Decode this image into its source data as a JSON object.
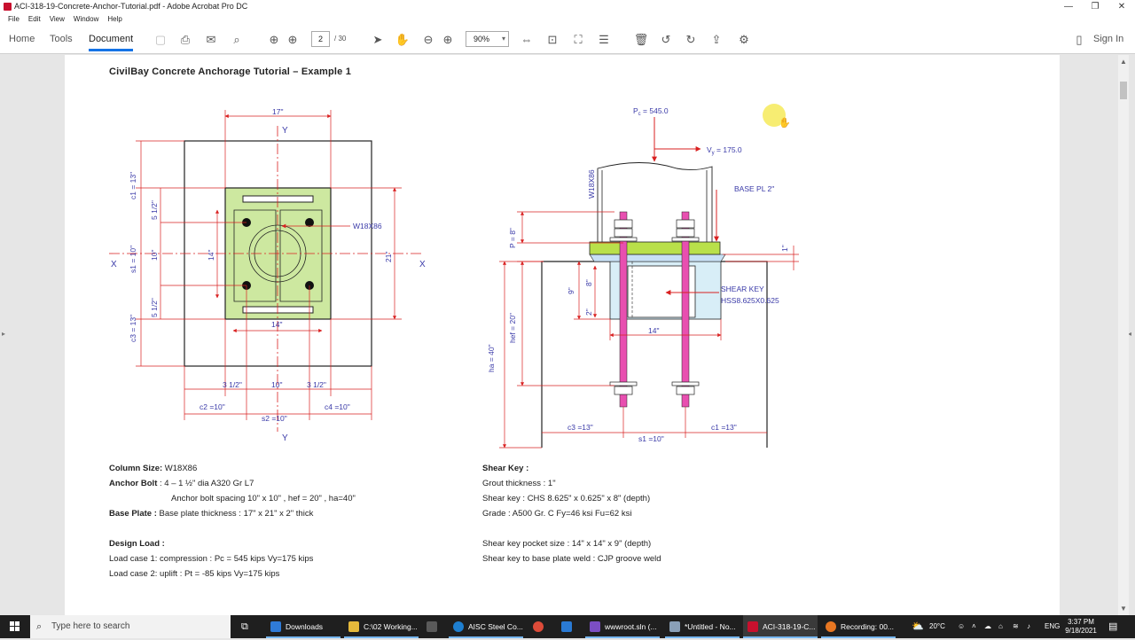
{
  "window": {
    "title": "ACI-318-19-Concrete-Anchor-Tutorial.pdf - Adobe Acrobat Pro DC",
    "controls": [
      "—",
      "❐",
      "✕"
    ]
  },
  "menu": [
    "File",
    "Edit",
    "View",
    "Window",
    "Help"
  ],
  "toolbar": {
    "tabs": [
      "Home",
      "Tools",
      "Document"
    ],
    "active_tab": "Document",
    "page_current": "2",
    "page_total": "/ 30",
    "zoom": "90%",
    "sign_in": "Sign In"
  },
  "document": {
    "title": "CivilBay Concrete Anchorage Tutorial – Example 1",
    "plan_view": {
      "dims": {
        "top_17": "17\"",
        "c1": "c1 = 13\"",
        "half_a": "5 1/2\"",
        "s1": "s1 = 10\"",
        "ten": "10\"",
        "half_b": "5 1/2\"",
        "c3": "c3 = 13\"",
        "fourteen_v": "14\"",
        "fourteen_h": "14\"",
        "twentyone": "21\"",
        "three_half_a": "3 1/2\"",
        "ten_b": "10\"",
        "three_half_b": "3 1/2\"",
        "c2": "c2 =10\"",
        "s2": "s2 =10\"",
        "c4": "c4 =10\""
      },
      "axes": {
        "y_top": "Y",
        "y_bottom": "Y",
        "x_left": "X",
        "x_right": "X"
      },
      "column_label": "W18X86"
    },
    "elevation_view": {
      "pc": "545.0",
      "vy": "175.0",
      "column_label": "W18X86",
      "base_pl": "BASE PL 2\"",
      "shear_key_1": "SHEAR KEY",
      "shear_key_2": "HSS8.625X0.625",
      "dims": {
        "p": "P = 8\"",
        "one": "1\"",
        "nine": "9\"",
        "eight": "8\"",
        "two": "2\"",
        "hef": "hef = 20\"",
        "fourteen": "14\"",
        "ha": "ha = 40\"",
        "c3": "c3 =13\"",
        "s1": "s1 =10\"",
        "c1": "c1 =13\""
      }
    },
    "specs_left": [
      {
        "label": "Column Size:",
        "value": " W18X86"
      },
      {
        "label": "Anchor Bolt",
        "value": " : 4 – 1 ½\" dia A320 Gr L7"
      },
      {
        "label": "",
        "value": "Anchor bolt spacing 10\" x 10\"   , hef = 20\" , ha=40\""
      },
      {
        "label": "Base Plate :",
        "value": " Base plate thickness : 17\" x 21\" x 2\" thick"
      },
      {
        "label": "Design Load :",
        "value": ""
      },
      {
        "label": "",
        "value": "Load case 1:   compression :  Pc =  545 kips          Vy=175 kips"
      },
      {
        "label": "",
        "value": "Load case 2:   uplift            :  Pt =  -85 kips          Vy=175 kips"
      }
    ],
    "specs_right": [
      {
        "label": "Shear Key :",
        "value": ""
      },
      {
        "label": "",
        "value": "Grout thickness : 1\""
      },
      {
        "label": "",
        "value": "Shear key : CHS 8.625\" x 0.625\" x 8\" (depth)"
      },
      {
        "label": "",
        "value": "Grade : A500 Gr. C   Fy=46 ksi       Fu=62 ksi"
      },
      {
        "label": "",
        "value": "Shear key pocket size : 14\" x 14\" x 9\" (depth)"
      },
      {
        "label": "",
        "value": "Shear key to base plate weld : CJP groove weld"
      }
    ]
  },
  "colors": {
    "dim_red": "#d92020",
    "label_blue": "#3a3aa8",
    "plate_green": "#cde8a0",
    "bolt_magenta": "#e84fb0",
    "key_blue": "#c8e0f4",
    "accent": "#1473e6"
  },
  "taskbar": {
    "search_placeholder": "Type here to search",
    "apps": [
      {
        "label": "Downloads",
        "color": "#2f7bd8",
        "state": "open"
      },
      {
        "label": "C:\\02 Working...",
        "color": "#e5b93b",
        "state": "open"
      },
      {
        "label": "",
        "color": "#5a5a5a",
        "state": ""
      },
      {
        "label": "AISC Steel Co...",
        "color": "#1e7fd0",
        "state": "open"
      },
      {
        "label": "",
        "color": "#dd4b39",
        "state": ""
      },
      {
        "label": "",
        "color": "#2a7ad4",
        "state": ""
      },
      {
        "label": "wwwroot.sln (...",
        "color": "#7b4ec3",
        "state": "open"
      },
      {
        "label": "*Untitled - No...",
        "color": "#8aa0b8",
        "state": "open"
      },
      {
        "label": "ACI-318-19-C...",
        "color": "#c8102e",
        "state": "active"
      },
      {
        "label": "Recording: 00...",
        "color": "#e87722",
        "state": "open"
      }
    ],
    "weather": "20°C",
    "language": "ENG",
    "time": "3:37 PM",
    "date": "9/18/2021"
  }
}
